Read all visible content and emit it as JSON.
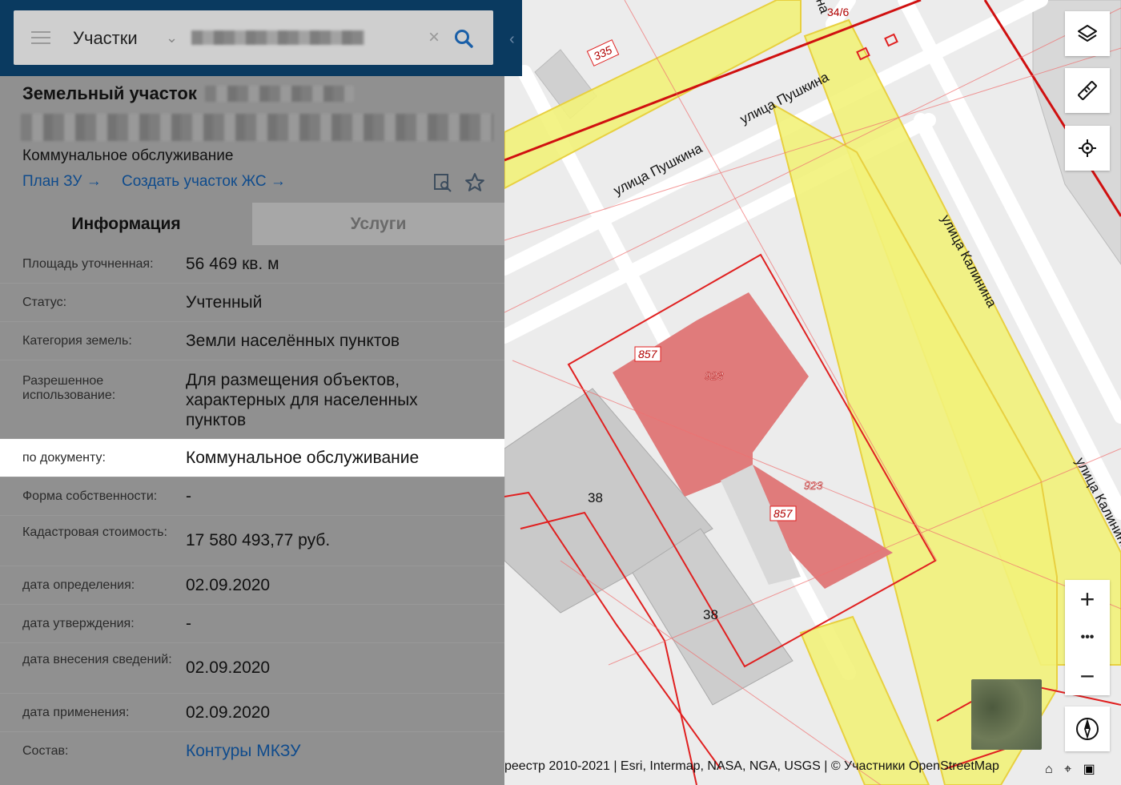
{
  "search": {
    "layer_label": "Участки",
    "clear_label": "×"
  },
  "parcel": {
    "title": "Земельный участок",
    "subtitle": "Коммунальное обслуживание",
    "links": [
      "План ЗУ",
      "Создать участок ЖС"
    ]
  },
  "tabs": [
    "Информация",
    "Услуги"
  ],
  "info": [
    {
      "key": "Площадь уточненная:",
      "value": "56 469 кв. м"
    },
    {
      "key": "Статус:",
      "value": "Учтенный"
    },
    {
      "key": "Категория земель:",
      "value": "Земли населённых пунктов"
    },
    {
      "key": "Разрешенное использование:",
      "value": "Для размещения объектов, характерных для населенных пунктов"
    },
    {
      "key": "по документу:",
      "value": "Коммунальное обслуживание"
    },
    {
      "key": "Форма собственности:",
      "value": "-"
    },
    {
      "key": "Кадастровая стоимость:",
      "value": "17 580 493,77 руб."
    },
    {
      "key": "дата определения:",
      "value": "02.09.2020"
    },
    {
      "key": "дата утверждения:",
      "value": "-"
    },
    {
      "key": "дата внесения сведений:",
      "value": "02.09.2020"
    },
    {
      "key": "дата применения:",
      "value": "02.09.2020"
    },
    {
      "key": "Состав:",
      "value": "Контуры МКЗУ"
    }
  ],
  "map": {
    "street_labels": [
      "улица Пушкина",
      "улица Пушкина",
      "улица Калинина",
      "улица Калинина",
      "на",
      "34/6"
    ],
    "parcel_numbers": [
      "335",
      "857",
      "923",
      "923",
      "857"
    ],
    "building_numbers": [
      "38",
      "38"
    ],
    "attribution": "реестр 2010-2021 | Esri, Intermap, NASA, NGA, USGS | © Участники OpenStreetMap"
  },
  "zoom": {
    "in": "+",
    "more": "•••",
    "out": "−"
  },
  "colors": {
    "header": "#0a3a60",
    "link": "#0f4b8c",
    "yellow_zone": "#f2f27a",
    "parcel_red": "#e07b7b",
    "border_red": "#e02020"
  }
}
